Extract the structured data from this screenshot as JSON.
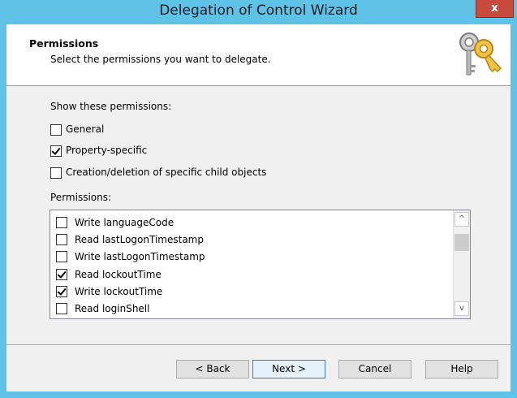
{
  "window": {
    "title": "Delegation of Control Wizard",
    "close_label": "x"
  },
  "header": {
    "title": "Permissions",
    "subtitle": "Select the permissions you want to delegate.",
    "icon": "keys-icon"
  },
  "show_permissions": {
    "label": "Show these permissions:",
    "options": [
      {
        "label": "General",
        "checked": false
      },
      {
        "label": "Property-specific",
        "checked": true
      },
      {
        "label": "Creation/deletion of specific child objects",
        "checked": false
      }
    ]
  },
  "permissions": {
    "label": "Permissions:",
    "items": [
      {
        "label": "Write languageCode",
        "checked": false
      },
      {
        "label": "Read lastLogonTimestamp",
        "checked": false
      },
      {
        "label": "Write lastLogonTimestamp",
        "checked": false
      },
      {
        "label": "Read lockoutTime",
        "checked": true
      },
      {
        "label": "Write lockoutTime",
        "checked": true
      },
      {
        "label": "Read loginShell",
        "checked": false
      }
    ]
  },
  "scrollbar": {
    "up_icon": "chevron-up-icon",
    "down_icon": "chevron-down-icon",
    "up_glyph": "^",
    "down_glyph": "v"
  },
  "buttons": {
    "back": "< Back",
    "next": "Next >",
    "cancel": "Cancel",
    "help": "Help"
  }
}
